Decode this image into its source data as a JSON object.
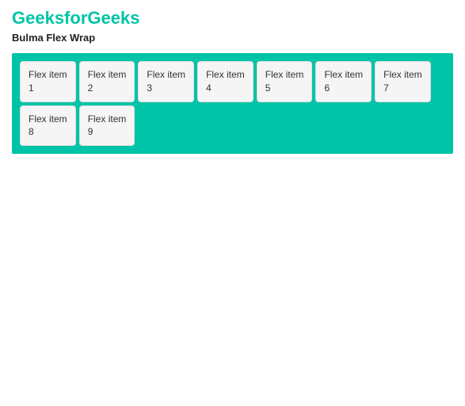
{
  "header": {
    "site_title": "GeeksforGeeks",
    "page_title": "Bulma Flex Wrap"
  },
  "flex_items": [
    {
      "label": "Flex item",
      "number": "1"
    },
    {
      "label": "Flex item",
      "number": "2"
    },
    {
      "label": "Flex item",
      "number": "3"
    },
    {
      "label": "Flex item",
      "number": "4"
    },
    {
      "label": "Flex item",
      "number": "5"
    },
    {
      "label": "Flex item",
      "number": "6"
    },
    {
      "label": "Flex item",
      "number": "7"
    },
    {
      "label": "Flex item",
      "number": "8"
    },
    {
      "label": "Flex item",
      "number": "9"
    }
  ]
}
